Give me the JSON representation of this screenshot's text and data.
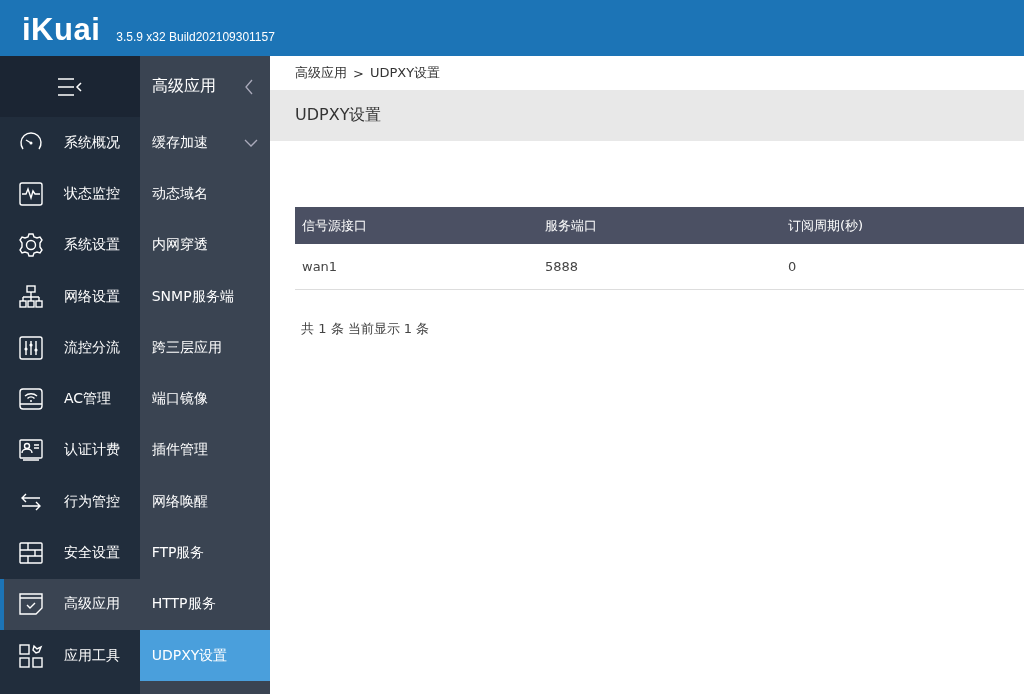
{
  "header": {
    "logo": "iKuai",
    "version": "3.5.9 x32 Build202109301157"
  },
  "nav": {
    "items": [
      {
        "label": "系统概况",
        "selected": false
      },
      {
        "label": "状态监控",
        "selected": false
      },
      {
        "label": "系统设置",
        "selected": false
      },
      {
        "label": "网络设置",
        "selected": false
      },
      {
        "label": "流控分流",
        "selected": false
      },
      {
        "label": "AC管理",
        "selected": false
      },
      {
        "label": "认证计费",
        "selected": false
      },
      {
        "label": "行为管控",
        "selected": false
      },
      {
        "label": "安全设置",
        "selected": false
      },
      {
        "label": "高级应用",
        "selected": true
      },
      {
        "label": "应用工具",
        "selected": false
      }
    ]
  },
  "submenu": {
    "title": "高级应用",
    "items": [
      {
        "label": "缓存加速",
        "kind": "group",
        "selected": false
      },
      {
        "label": "动态域名",
        "kind": "link",
        "selected": false
      },
      {
        "label": "内网穿透",
        "kind": "link",
        "selected": false
      },
      {
        "label": "SNMP服务端",
        "kind": "link",
        "selected": false
      },
      {
        "label": "跨三层应用",
        "kind": "link",
        "selected": false
      },
      {
        "label": "端口镜像",
        "kind": "link",
        "selected": false
      },
      {
        "label": "插件管理",
        "kind": "link",
        "selected": false
      },
      {
        "label": "网络唤醒",
        "kind": "link",
        "selected": false
      },
      {
        "label": "FTP服务",
        "kind": "link",
        "selected": false
      },
      {
        "label": "HTTP服务",
        "kind": "link",
        "selected": false
      },
      {
        "label": "UDPXY设置",
        "kind": "link",
        "selected": true
      }
    ]
  },
  "breadcrumb": [
    "高级应用",
    "UDPXY设置"
  ],
  "breadcrumb_separator": ">",
  "page_title": "UDPXY设置",
  "table": {
    "columns": [
      "信号源接口",
      "服务端口",
      "订阅周期(秒)"
    ],
    "rows": [
      [
        "wan1",
        "5888",
        "0"
      ]
    ]
  },
  "footer": "共 1 条 当前显示 1 条"
}
